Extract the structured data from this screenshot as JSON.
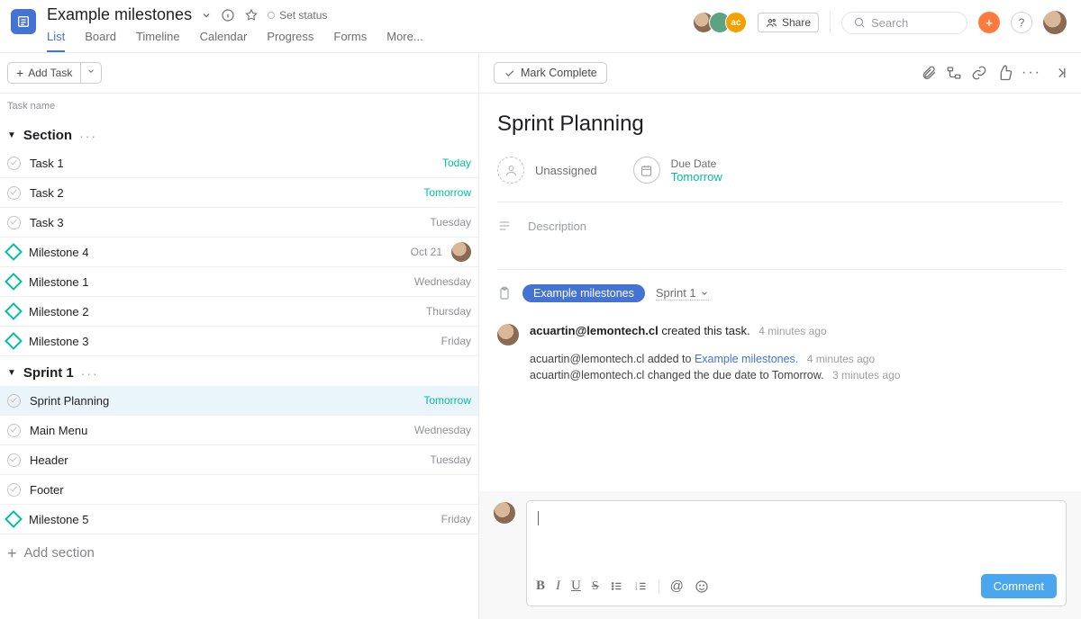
{
  "header": {
    "project_title": "Example milestones",
    "set_status": "Set status",
    "tabs": [
      "List",
      "Board",
      "Timeline",
      "Calendar",
      "Progress",
      "Forms",
      "More..."
    ],
    "active_tab": 0,
    "share_label": "Share",
    "search_placeholder": "Search",
    "avatar_initials": [
      "",
      "",
      "ac"
    ]
  },
  "left": {
    "add_task_label": "Add Task",
    "column_header": "Task name",
    "sections": [
      {
        "name": "Section",
        "rows": [
          {
            "type": "task",
            "name": "Task 1",
            "due": "Today",
            "due_color": "green"
          },
          {
            "type": "task",
            "name": "Task 2",
            "due": "Tomorrow",
            "due_color": "green"
          },
          {
            "type": "task",
            "name": "Task 3",
            "due": "Tuesday",
            "due_color": ""
          },
          {
            "type": "milestone",
            "name": "Milestone 4",
            "due": "Oct 21",
            "due_color": "",
            "has_avatar": true
          },
          {
            "type": "milestone",
            "name": "Milestone 1",
            "due": "Wednesday",
            "due_color": ""
          },
          {
            "type": "milestone",
            "name": "Milestone 2",
            "due": "Thursday",
            "due_color": ""
          },
          {
            "type": "milestone",
            "name": "Milestone 3",
            "due": "Friday",
            "due_color": ""
          }
        ]
      },
      {
        "name": "Sprint 1",
        "rows": [
          {
            "type": "task",
            "name": "Sprint Planning",
            "due": "Tomorrow",
            "due_color": "green",
            "selected": true
          },
          {
            "type": "task",
            "name": "Main Menu",
            "due": "Wednesday",
            "due_color": ""
          },
          {
            "type": "task",
            "name": "Header",
            "due": "Tuesday",
            "due_color": ""
          },
          {
            "type": "task",
            "name": "Footer",
            "due": "",
            "due_color": ""
          },
          {
            "type": "milestone",
            "name": "Milestone 5",
            "due": "Friday",
            "due_color": ""
          }
        ]
      }
    ],
    "add_section_label": "Add section"
  },
  "detail": {
    "mark_complete": "Mark Complete",
    "title": "Sprint Planning",
    "assignee_label": "Unassigned",
    "due_label": "Due Date",
    "due_value": "Tomorrow",
    "description_placeholder": "Description",
    "project_pill": "Example milestones",
    "project_section": "Sprint 1",
    "activity": {
      "creator": "acuartin@lemontech.cl",
      "created_text": "created this task.",
      "created_time": "4 minutes ago",
      "entries": [
        {
          "who": "acuartin@lemontech.cl",
          "text": "added to",
          "link": "Example milestones.",
          "time": "4 minutes ago"
        },
        {
          "who": "acuartin@lemontech.cl",
          "text": "changed the due date to Tomorrow.",
          "link": "",
          "time": "3 minutes ago"
        }
      ]
    },
    "comment_button": "Comment"
  }
}
